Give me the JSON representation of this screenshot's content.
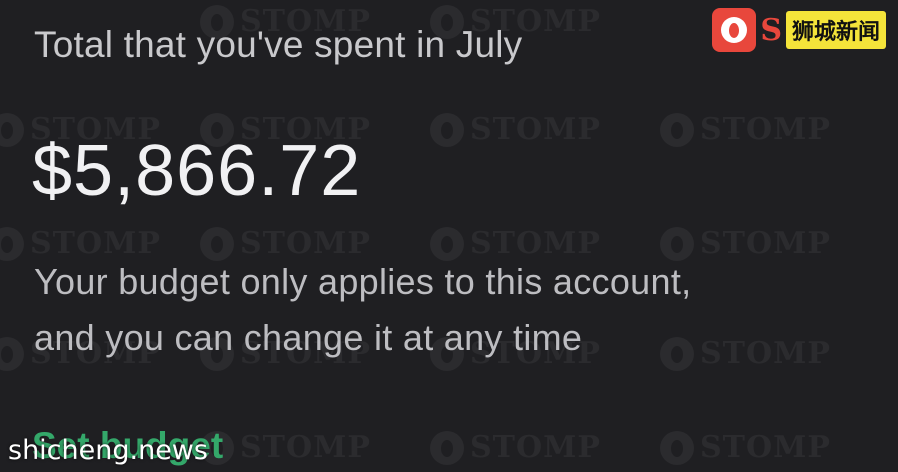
{
  "budget": {
    "heading": "Total that you've spent in July",
    "amount": "$5,866.72",
    "note_line1": "Your budget only applies to this account,",
    "note_line2": "and you can change it at any time",
    "action_label": "Set budget"
  },
  "overlay": {
    "logo_letter": "S",
    "logo_cn": "狮城新闻",
    "site": "shicheng.news",
    "watermark_text": "STOMP"
  },
  "colors": {
    "background": "#1f1f22",
    "heading": "#c9c9cc",
    "amount": "#f1f1f3",
    "note": "#bdbdc1",
    "accent": "#34a86a",
    "logo_red": "#e8473c",
    "logo_yellow": "#f4e43a"
  },
  "icons": {
    "logo": "footprint-logo-icon",
    "watermark": "stomp-watermark-icon"
  }
}
